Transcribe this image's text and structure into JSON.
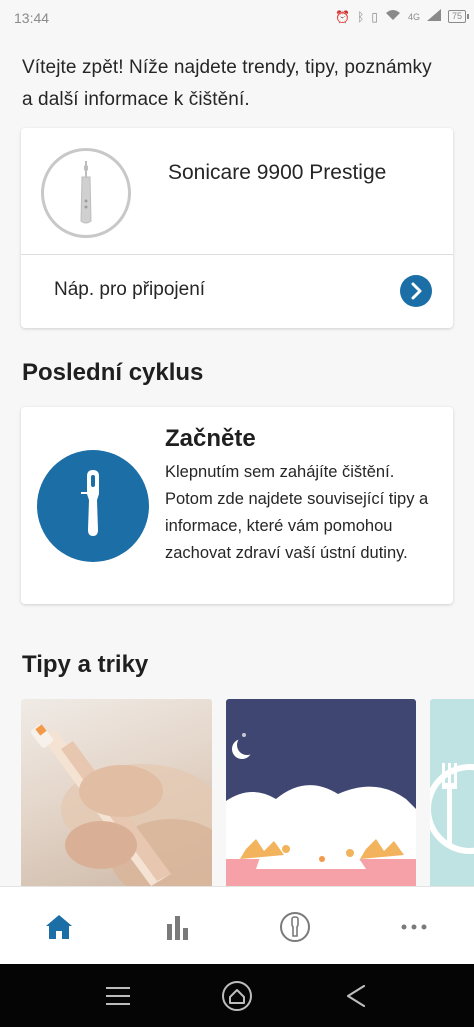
{
  "status_bar": {
    "time": "13:44",
    "network": "4G",
    "battery": "75"
  },
  "intro_text": "Vítejte zpět! Níže najdete trendy, tipy, poznámky a další informace k čištění.",
  "device": {
    "name": "Sonicare 9900 Prestige",
    "connect_label": "Náp. pro připojení"
  },
  "last_cycle": {
    "section_title": "Poslední cyklus",
    "title": "Začněte",
    "text": "Klepnutím sem zahájíte čištění. Potom zde najdete související tipy a informace, které vám pomohou zachovat zdraví vaší ústní dutiny."
  },
  "tips": {
    "section_title": "Tipy a triky",
    "cards": [
      "tip-toothbrush-photo",
      "tip-teeth-illustration",
      "tip-fork-illustration"
    ]
  },
  "bottom_nav": {
    "items": [
      "home-icon",
      "stats-icon",
      "brush-head-icon",
      "more-icon"
    ],
    "active": "home-icon",
    "active_color": "#1b6ea6",
    "inactive_color": "#7a7a7a"
  },
  "system_nav": {
    "items": [
      "menu-icon",
      "home-icon",
      "back-icon"
    ]
  },
  "colors": {
    "accent": "#1b6ea6",
    "background": "#f7f7f7"
  }
}
